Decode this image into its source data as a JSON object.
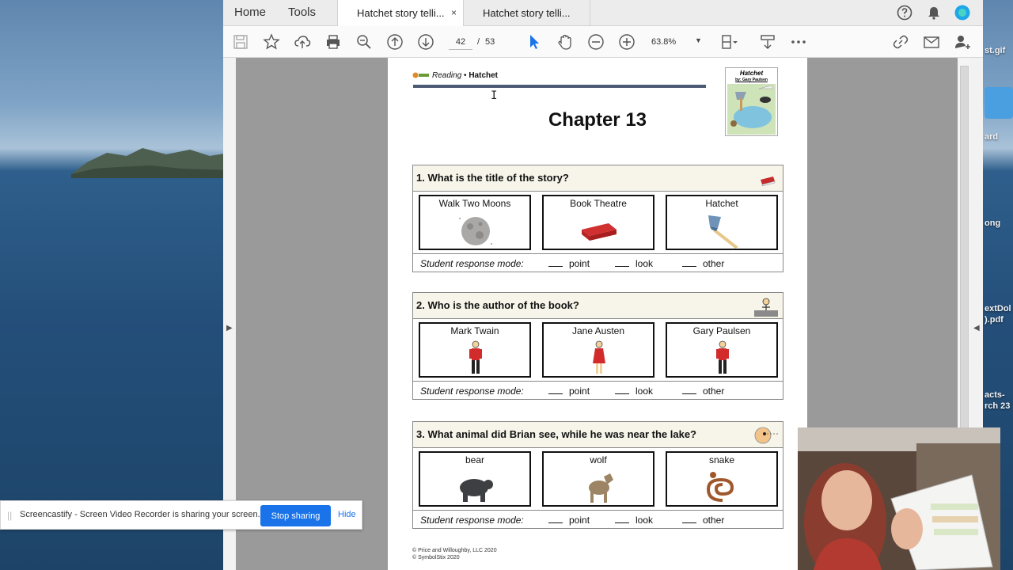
{
  "desktop": {
    "labels": [
      "st.gif",
      "ard",
      "ong",
      "extDol",
      ").pdf",
      "acts-",
      "rch 23"
    ]
  },
  "app": {
    "nav": {
      "home": "Home",
      "tools": "Tools"
    },
    "tabs": [
      {
        "label": "Hatchet story telli...",
        "close": "×"
      },
      {
        "label": "Hatchet story telli..."
      }
    ],
    "toolbar": {
      "page_current": "42",
      "page_sep": "/",
      "page_total": "53",
      "zoom": "63.8%"
    }
  },
  "document": {
    "header_subject": "Reading",
    "header_bullet": " • ",
    "header_book": "Hatchet",
    "cover_title": "Hatchet",
    "cover_author": "by: Gary Paulsen",
    "chapter": "Chapter 13",
    "questions": [
      {
        "text": "1. What is the title of the story?",
        "choices": [
          "Walk Two Moons",
          "Book Theatre",
          "Hatchet"
        ]
      },
      {
        "text": "2. Who is the author of the book?",
        "choices": [
          "Mark Twain",
          "Jane Austen",
          "Gary Paulsen"
        ]
      },
      {
        "text": "3. What animal did Brian see, while he was near the lake?",
        "choices": [
          "bear",
          "wolf",
          "snake"
        ]
      }
    ],
    "response": {
      "lead": "Student response mode:",
      "options": [
        "point",
        "look",
        "other"
      ]
    },
    "footer": [
      "© Price and Willoughby, LLC 2020",
      "© SymbolStix 2020"
    ]
  },
  "share_bar": {
    "grip": "||",
    "message": "Screencastify - Screen Video Recorder is sharing your screen.",
    "stop_label": "Stop sharing",
    "hide_label": "Hide"
  },
  "colors": {
    "accent_blue": "#1a73e8",
    "header_rule": "#4c5b74",
    "question_band": "#f7f5ea"
  }
}
